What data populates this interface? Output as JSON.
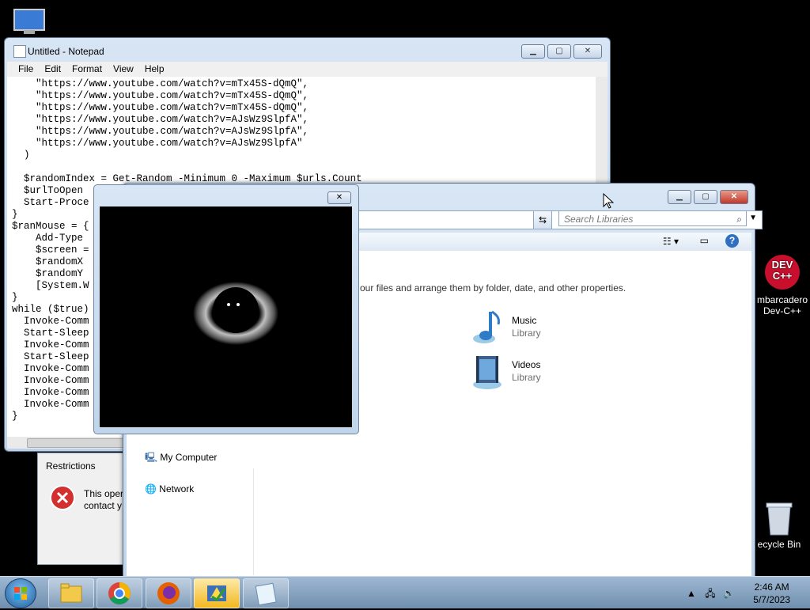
{
  "desktop": {
    "icons": [
      {
        "label": "mbarcadero\nDev-C++"
      },
      {
        "label": "ecycle Bin"
      }
    ],
    "devcpp_badge": "DEV\nC++"
  },
  "notepad": {
    "title": "Untitled - Notepad",
    "menu": [
      "File",
      "Edit",
      "Format",
      "View",
      "Help"
    ],
    "code": "    \"https://www.youtube.com/watch?v=mTx45S-dQmQ\",\n    \"https://www.youtube.com/watch?v=mTx45S-dQmQ\",\n    \"https://www.youtube.com/watch?v=mTx45S-dQmQ\",\n    \"https://www.youtube.com/watch?v=AJsWz9SlpfA\",\n    \"https://www.youtube.com/watch?v=AJsWz9SlpfA\",\n    \"https://www.youtube.com/watch?v=AJsWz9SlpfA\"\n  )\n\n  $randomIndex = Get-Random -Minimum 0 -Maximum $urls.Count\n  $urlToOpen\n  Start-Proce\n}\n$ranMouse = {\n    Add-Type\n    $screen =\n    $randomX\n    $randomY\n    [System.W\n}\nwhile ($true)\n  Invoke-Comm\n  Start-Sleep\n  Invoke-Comm\n  Start-Sleep\n  Invoke-Comm\n  Invoke-Comm\n  Invoke-Comm\n  Invoke-Comm\n}"
  },
  "explorer": {
    "search_placeholder": "Search Libraries",
    "description": "our files and arrange them by folder, date, and other properties.",
    "libraries": [
      {
        "name": "Music",
        "type": "Library"
      },
      {
        "name": "Videos",
        "type": "Library"
      }
    ],
    "nav": [
      {
        "label": "My Computer"
      },
      {
        "label": "Network"
      }
    ]
  },
  "restrictions": {
    "title": "Restrictions",
    "message_line1": "This oper",
    "message_line2": "contact y"
  },
  "taskbar": {
    "time": "2:46 AM",
    "date": "5/7/2023",
    "buttons": [
      "explorer",
      "chrome",
      "firefox",
      "task-manager",
      "notepad"
    ]
  },
  "colors": {
    "accent": "#3b6ea5",
    "error": "#d32f2f",
    "taskbar": "#7f9cbc"
  }
}
